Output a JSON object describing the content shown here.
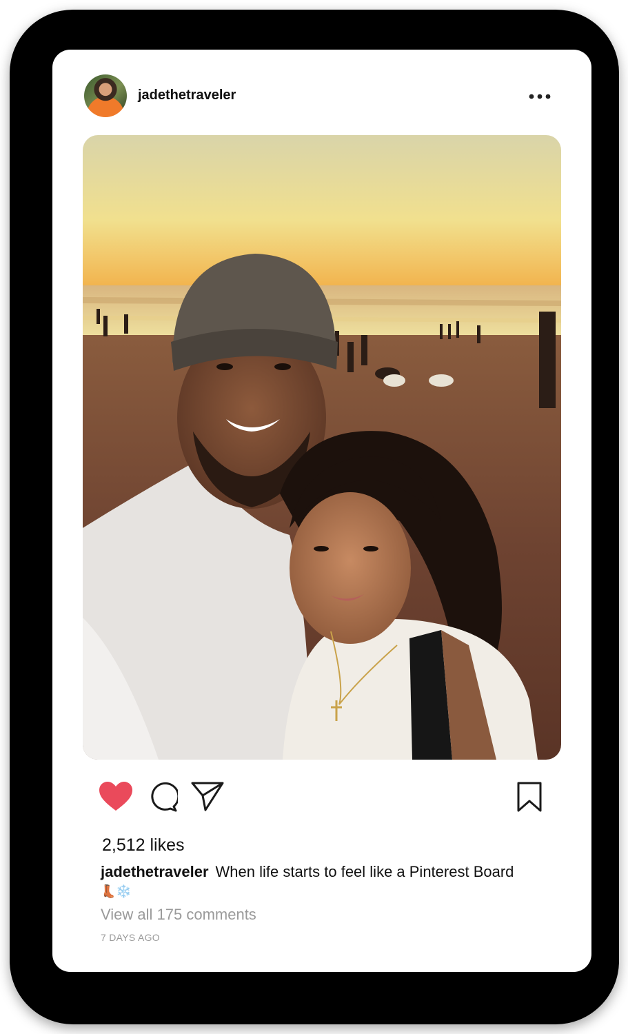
{
  "post": {
    "username": "jadethetraveler",
    "more_icon": "more-horizontal-icon",
    "photo_icon": "photo"
  },
  "actions": {
    "like_icon": "heart-filled-icon",
    "like_color": "#ea4a5b",
    "comment_icon": "comment-icon",
    "share_icon": "send-icon",
    "save_icon": "bookmark-icon"
  },
  "likes": "2,512 likes",
  "caption": {
    "username": "jadethetraveler",
    "text": "When life starts to feel like a Pinterest Board",
    "emoji_boot": "👢",
    "emoji_snow": "❄️"
  },
  "comments": {
    "view_all": "View all 175 comments"
  },
  "timestamp": "7 DAYS AGO"
}
